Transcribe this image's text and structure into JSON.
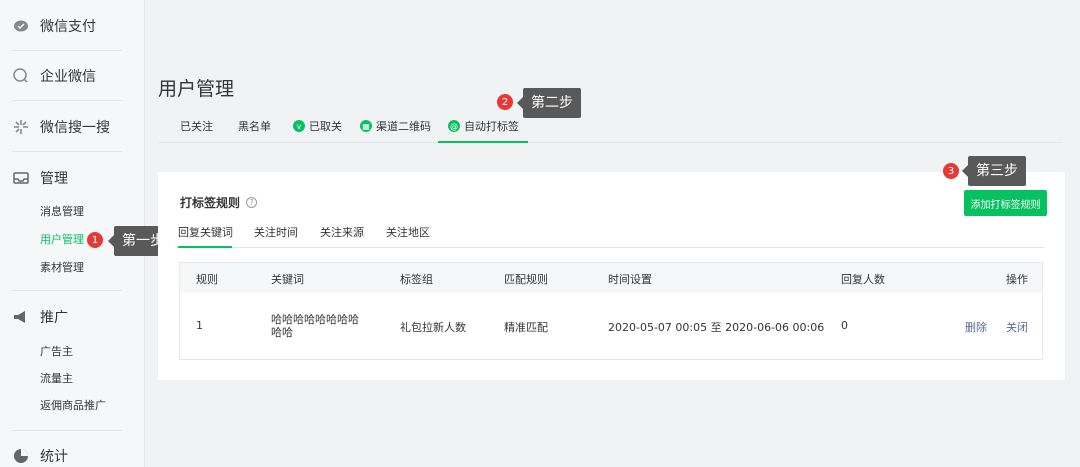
{
  "sidebar": {
    "groups": [
      {
        "label": "微信支付",
        "icon": "wechat-pay-icon"
      },
      {
        "label": "企业微信",
        "icon": "work-wechat-icon"
      },
      {
        "label": "微信搜一搜",
        "icon": "search-sparkle-icon"
      },
      {
        "label": "管理",
        "icon": "inbox-icon"
      },
      {
        "label": "推广",
        "icon": "megaphone-icon"
      },
      {
        "label": "统计",
        "icon": "pie-chart-icon"
      }
    ],
    "manage_items": [
      "消息管理",
      "用户管理",
      "素材管理"
    ],
    "promote_items": [
      "广告主",
      "流量主",
      "返佣商品推广"
    ]
  },
  "steps": {
    "step1": {
      "badge": "1",
      "label": "第一步"
    },
    "step2": {
      "badge": "2",
      "label": "第二步"
    },
    "step3": {
      "badge": "3",
      "label": "第三步"
    }
  },
  "page": {
    "title": "用户管理",
    "tabs": [
      "已关注",
      "黑名单",
      "已取关",
      "渠道二维码",
      "自动打标签"
    ],
    "tab_icons": [
      "v",
      "",
      "@"
    ]
  },
  "card": {
    "title": "打标签规则",
    "help": "?",
    "add_button": "添加打标签规则",
    "subtabs": [
      "回复关键词",
      "关注时间",
      "关注来源",
      "关注地区"
    ],
    "table": {
      "headers": [
        "规则",
        "关键词",
        "标签组",
        "匹配规则",
        "时间设置",
        "回复人数",
        "操作"
      ],
      "rows": [
        {
          "rule": "1",
          "keyword_line1": "哈哈哈哈哈哈哈哈",
          "keyword_line2": "哈哈",
          "tag_group": "礼包拉新人数",
          "match": "精准匹配",
          "time": "2020-05-07 00:05 至 2020-06-06 00:06",
          "count": "0",
          "action_delete": "删除",
          "action_close": "关闭"
        }
      ]
    }
  },
  "colors": {
    "accent": "#07c160",
    "link": "#576b95",
    "badge": "#e53935",
    "tip": "#595959"
  }
}
